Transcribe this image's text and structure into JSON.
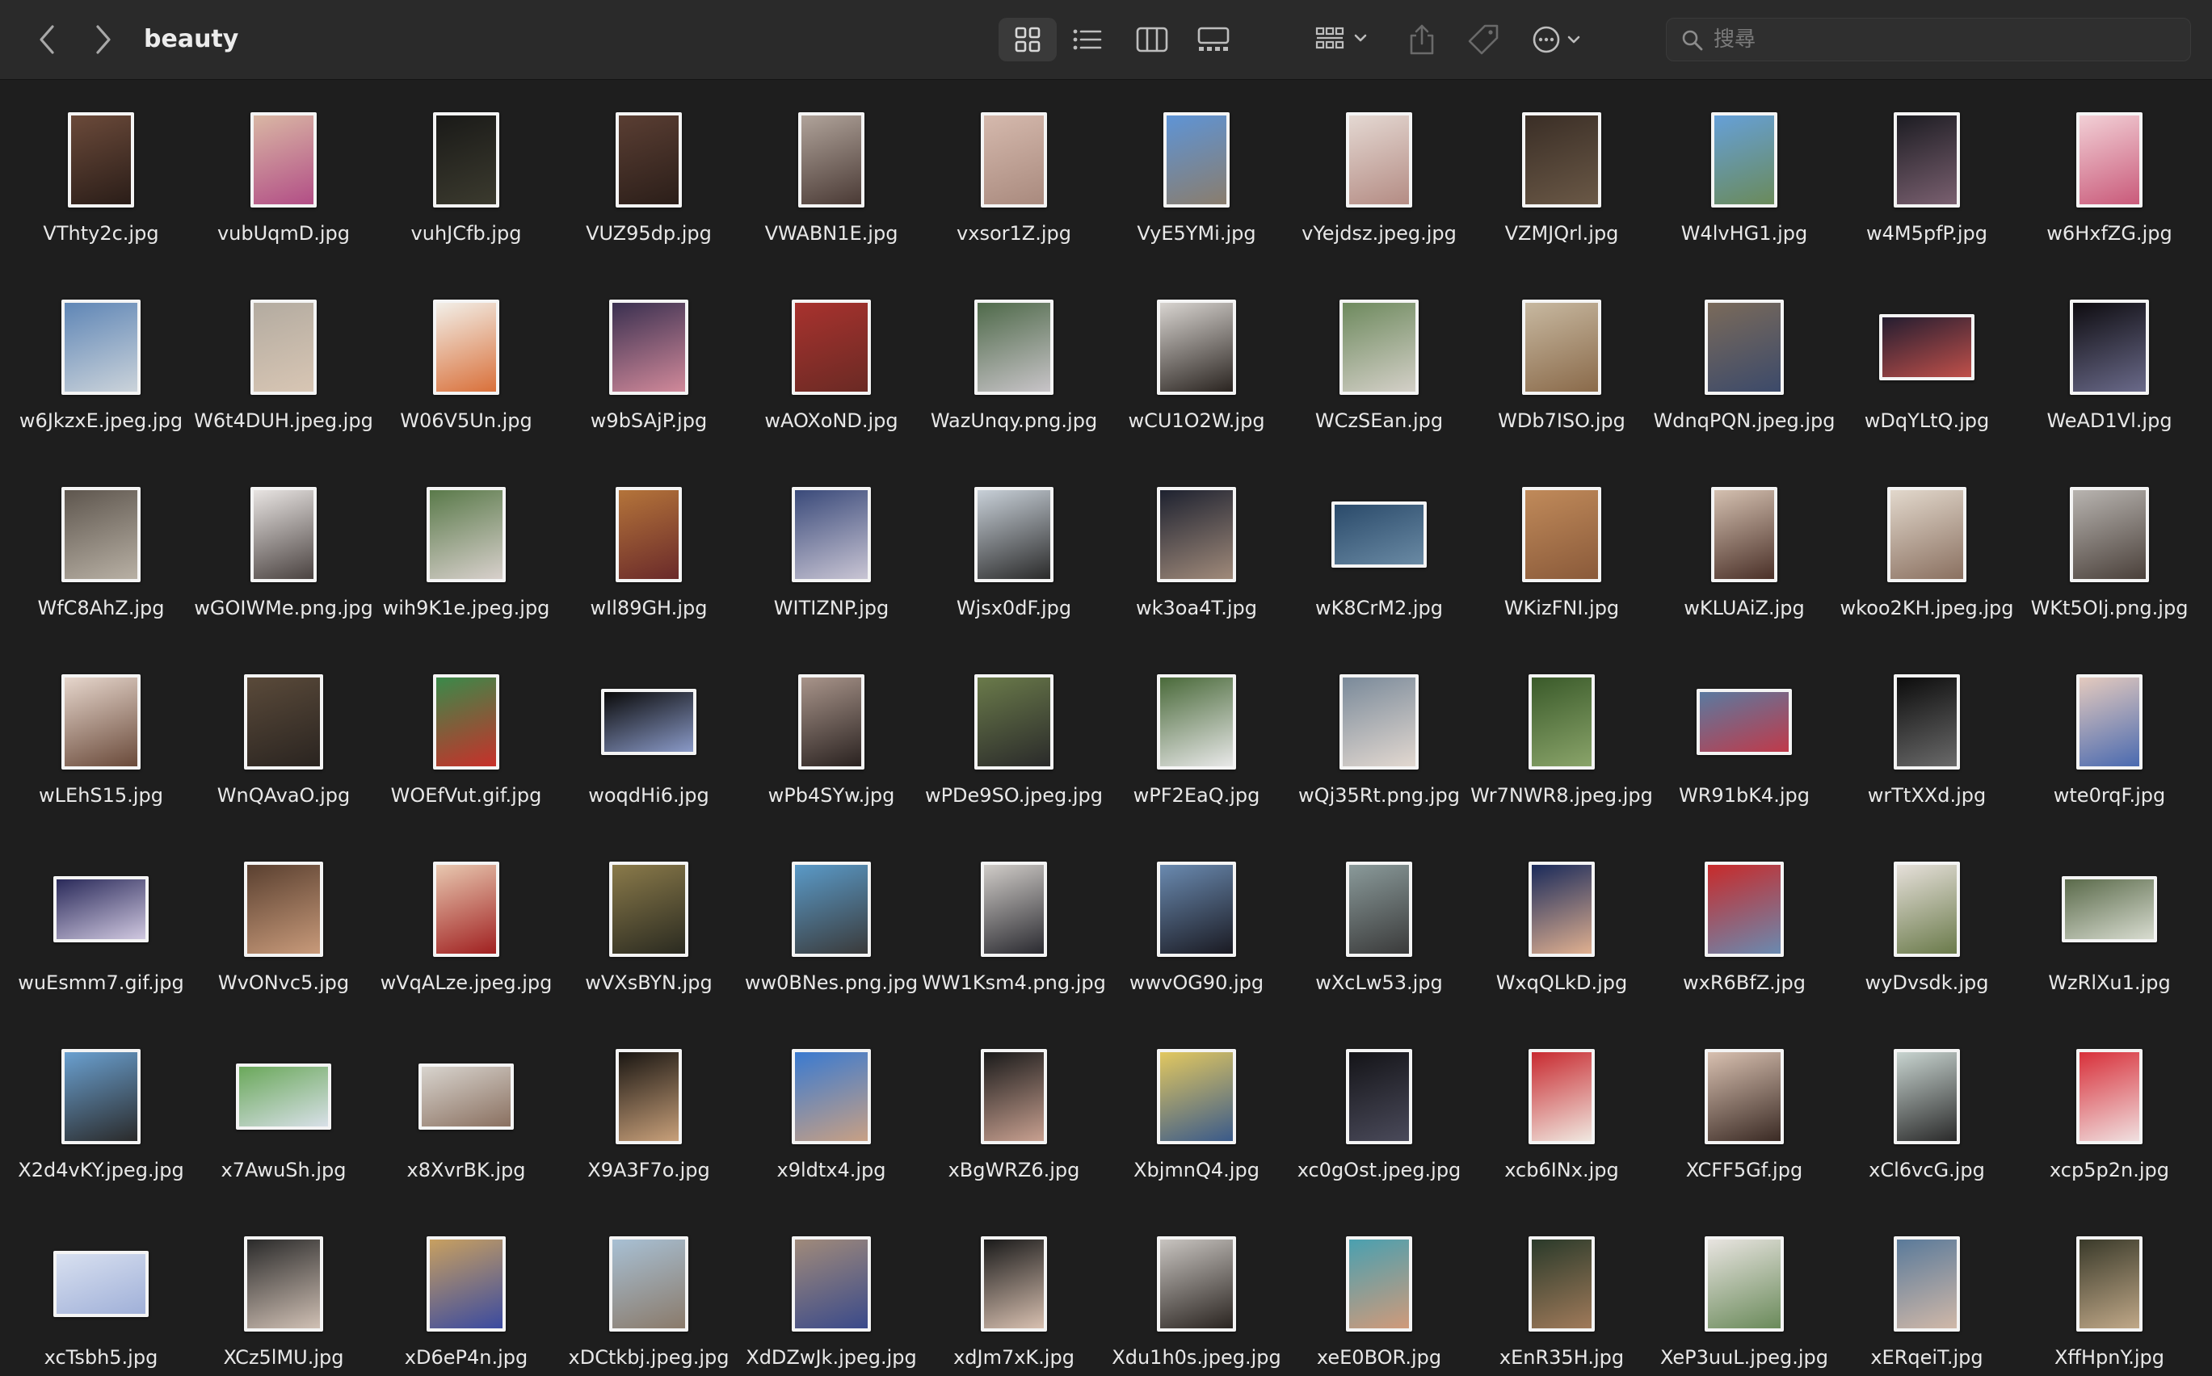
{
  "window": {
    "folder_title": "beauty",
    "search": {
      "placeholder": "搜尋",
      "value": ""
    }
  },
  "toolbar": {
    "icons": [
      "chevron-left-icon",
      "chevron-right-icon",
      "grid-icon",
      "list-icon",
      "columns-icon",
      "gallery-icon",
      "group-icon",
      "share-icon",
      "tag-icon",
      "more-icon",
      "search-icon"
    ],
    "active_view": "icon"
  },
  "colors": {
    "background": "#1e1e1e",
    "toolbar": "#2a2a2a",
    "text": "#e8e8e8",
    "thumb_border": "#f4f4f4"
  },
  "files": [
    {
      "name": "VThty2c.jpg",
      "shape": "p",
      "colors": [
        "#6b4a3a",
        "#2a1d18"
      ]
    },
    {
      "name": "vubUqmD.jpg",
      "shape": "p",
      "colors": [
        "#d9b7a4",
        "#b24e86"
      ]
    },
    {
      "name": "vuhJCfb.jpg",
      "shape": "p",
      "colors": [
        "#1a1a18",
        "#3b3a2e"
      ]
    },
    {
      "name": "VUZ95dp.jpg",
      "shape": "p",
      "colors": [
        "#5a3e33",
        "#2b1e19"
      ]
    },
    {
      "name": "VWABN1E.jpg",
      "shape": "p",
      "colors": [
        "#b0a39a",
        "#4a3a35"
      ]
    },
    {
      "name": "vxsor1Z.jpg",
      "shape": "p",
      "colors": [
        "#d5b9ad",
        "#a98a7e"
      ]
    },
    {
      "name": "VyE5YMi.jpg",
      "shape": "p",
      "colors": [
        "#5e94d6",
        "#8a7d6d"
      ]
    },
    {
      "name": "vYejdsz.jpeg.jpg",
      "shape": "p",
      "colors": [
        "#e4d8d2",
        "#b48c84"
      ]
    },
    {
      "name": "VZMJQrl.jpg",
      "shape": "s",
      "colors": [
        "#3a2e26",
        "#6a5846"
      ]
    },
    {
      "name": "W4lvHG1.jpg",
      "shape": "p",
      "colors": [
        "#66a0d8",
        "#6a8a5a"
      ]
    },
    {
      "name": "w4M5pfP.jpg",
      "shape": "p",
      "colors": [
        "#1c1c22",
        "#7a6070"
      ]
    },
    {
      "name": "w6HxfZG.jpg",
      "shape": "p",
      "colors": [
        "#f2d0d6",
        "#c95a7a"
      ]
    },
    {
      "name": "w6JkzxE.jpeg.jpg",
      "shape": "s",
      "colors": [
        "#5f86b6",
        "#cbd3da"
      ]
    },
    {
      "name": "W6t4DUH.jpeg.jpg",
      "shape": "p",
      "colors": [
        "#b3aba0",
        "#d8c6b4"
      ]
    },
    {
      "name": "W06V5Un.jpg",
      "shape": "p",
      "colors": [
        "#f2efe8",
        "#d9703a"
      ]
    },
    {
      "name": "w9bSAjP.jpg",
      "shape": "s",
      "colors": [
        "#3a3050",
        "#d1899a"
      ]
    },
    {
      "name": "wAOXoND.jpg",
      "shape": "s",
      "colors": [
        "#a8322e",
        "#6a2a24"
      ]
    },
    {
      "name": "WazUnqy.png.jpg",
      "shape": "s",
      "colors": [
        "#4f6a4a",
        "#c8c4c8"
      ]
    },
    {
      "name": "wCU1O2W.jpg",
      "shape": "s",
      "colors": [
        "#d8d4d0",
        "#2a2420"
      ]
    },
    {
      "name": "WCzSEan.jpg",
      "shape": "s",
      "colors": [
        "#6e8a5e",
        "#d4d0c8"
      ]
    },
    {
      "name": "WDb7ISO.jpg",
      "shape": "s",
      "colors": [
        "#c7b8a0",
        "#8a6a4a"
      ]
    },
    {
      "name": "WdnqPQN.jpeg.jpg",
      "shape": "s",
      "colors": [
        "#7a6a5a",
        "#3c4a6a"
      ]
    },
    {
      "name": "wDqYLtQ.jpg",
      "shape": "l",
      "colors": [
        "#241d30",
        "#c0504a"
      ]
    },
    {
      "name": "WeAD1Vl.jpg",
      "shape": "s",
      "colors": [
        "#0e0c10",
        "#6a6a8a"
      ]
    },
    {
      "name": "WfC8AhZ.jpg",
      "shape": "s",
      "colors": [
        "#5e564e",
        "#b8b0a4"
      ]
    },
    {
      "name": "wGOIWMe.png.jpg",
      "shape": "p",
      "colors": [
        "#e8e4e2",
        "#4a4240"
      ]
    },
    {
      "name": "wih9K1e.jpeg.jpg",
      "shape": "s",
      "colors": [
        "#5a7a4a",
        "#d8d0cc"
      ]
    },
    {
      "name": "wIl89GH.jpg",
      "shape": "p",
      "colors": [
        "#b4743a",
        "#6a2a2a"
      ]
    },
    {
      "name": "WITIZNP.jpg",
      "shape": "s",
      "colors": [
        "#3a4a7a",
        "#c9c5d4"
      ]
    },
    {
      "name": "Wjsx0dF.jpg",
      "shape": "s",
      "colors": [
        "#c8d0d8",
        "#2a2a2a"
      ]
    },
    {
      "name": "wk3oa4T.jpg",
      "shape": "s",
      "colors": [
        "#1e2230",
        "#a08a7a"
      ]
    },
    {
      "name": "wK8CrM2.jpg",
      "shape": "l",
      "colors": [
        "#2a4a6a",
        "#6a8aa4"
      ]
    },
    {
      "name": "WKizFNI.jpg",
      "shape": "s",
      "colors": [
        "#c08a5a",
        "#8a5a3a"
      ]
    },
    {
      "name": "wKLUAiZ.jpg",
      "shape": "p",
      "colors": [
        "#d4c0b0",
        "#4a3028"
      ]
    },
    {
      "name": "wkoo2KH.jpeg.jpg",
      "shape": "s",
      "colors": [
        "#e2d8cc",
        "#8a7060"
      ]
    },
    {
      "name": "WKt5OIj.png.jpg",
      "shape": "s",
      "colors": [
        "#b8b4b0",
        "#4a403a"
      ]
    },
    {
      "name": "wLEhS15.jpg",
      "shape": "s",
      "colors": [
        "#e6d6cc",
        "#6a4a3a"
      ]
    },
    {
      "name": "WnQAvaO.jpg",
      "shape": "s",
      "colors": [
        "#5a4a3a",
        "#2a2420"
      ]
    },
    {
      "name": "WOEfVut.gif.jpg",
      "shape": "p",
      "colors": [
        "#3a8a4a",
        "#c8302a"
      ]
    },
    {
      "name": "woqdHi6.jpg",
      "shape": "l",
      "colors": [
        "#0a0a0a",
        "#8a9ac8"
      ]
    },
    {
      "name": "wPb4SYw.jpg",
      "shape": "p",
      "colors": [
        "#a8948a",
        "#2a2220"
      ]
    },
    {
      "name": "wPDe9SO.jpeg.jpg",
      "shape": "s",
      "colors": [
        "#6a7a4a",
        "#2a2a2a"
      ]
    },
    {
      "name": "wPF2EaQ.jpg",
      "shape": "s",
      "colors": [
        "#4a6a3a",
        "#e8e8e8"
      ]
    },
    {
      "name": "wQj35Rt.png.jpg",
      "shape": "s",
      "colors": [
        "#7a8a9a",
        "#e2d8d0"
      ]
    },
    {
      "name": "Wr7NWR8.jpeg.jpg",
      "shape": "p",
      "colors": [
        "#3a5a2a",
        "#8aa46a"
      ]
    },
    {
      "name": "WR91bK4.jpg",
      "shape": "l",
      "colors": [
        "#5a7aa0",
        "#c03a4a"
      ]
    },
    {
      "name": "wrTtXXd.jpg",
      "shape": "p",
      "colors": [
        "#0c0c0c",
        "#6a6a6a"
      ]
    },
    {
      "name": "wte0rqF.jpg",
      "shape": "p",
      "colors": [
        "#e4cabe",
        "#4a6ab0"
      ]
    },
    {
      "name": "wuEsmm7.gif.jpg",
      "shape": "l",
      "colors": [
        "#2a2a5a",
        "#d0c8e0"
      ]
    },
    {
      "name": "WvONvc5.jpg",
      "shape": "s",
      "colors": [
        "#5a4030",
        "#c89a7a"
      ]
    },
    {
      "name": "wVqALze.jpeg.jpg",
      "shape": "p",
      "colors": [
        "#e8c8b0",
        "#a02020"
      ]
    },
    {
      "name": "wVXsBYN.jpg",
      "shape": "s",
      "colors": [
        "#8a7a4a",
        "#2a2a20"
      ]
    },
    {
      "name": "ww0BNes.png.jpg",
      "shape": "s",
      "colors": [
        "#5a9ac8",
        "#3a3a3a"
      ]
    },
    {
      "name": "WW1Ksm4.png.jpg",
      "shape": "p",
      "colors": [
        "#d0ccc8",
        "#2a2a30"
      ]
    },
    {
      "name": "wwvOG90.jpg",
      "shape": "s",
      "colors": [
        "#6a8ab0",
        "#1a1a22"
      ]
    },
    {
      "name": "wXcLw53.jpg",
      "shape": "p",
      "colors": [
        "#8a9a9a",
        "#3a3a3a"
      ]
    },
    {
      "name": "WxqQLkD.jpg",
      "shape": "p",
      "colors": [
        "#1a2a5a",
        "#e0b090"
      ]
    },
    {
      "name": "wxR6BfZ.jpg",
      "shape": "s",
      "colors": [
        "#c82a2a",
        "#6a8ab0"
      ]
    },
    {
      "name": "wyDvsdk.jpg",
      "shape": "p",
      "colors": [
        "#e6e0da",
        "#6a7a4a"
      ]
    },
    {
      "name": "WzRlXu1.jpg",
      "shape": "l",
      "colors": [
        "#5a6a4a",
        "#d8dcd0"
      ]
    },
    {
      "name": "X2d4vKY.jpeg.jpg",
      "shape": "s",
      "colors": [
        "#6aa0d0",
        "#2a2a2a"
      ]
    },
    {
      "name": "x7AwuSh.jpg",
      "shape": "l",
      "colors": [
        "#6aa85a",
        "#d8e0e8"
      ]
    },
    {
      "name": "x8XvrBK.jpg",
      "shape": "l",
      "colors": [
        "#d8d4ce",
        "#8a7060"
      ]
    },
    {
      "name": "X9A3F7o.jpg",
      "shape": "p",
      "colors": [
        "#1a1612",
        "#c8a07a"
      ]
    },
    {
      "name": "x9ldtx4.jpg",
      "shape": "s",
      "colors": [
        "#3a7ad0",
        "#c8a084"
      ]
    },
    {
      "name": "xBgWRZ6.jpg",
      "shape": "p",
      "colors": [
        "#1a1a1a",
        "#c8a090"
      ]
    },
    {
      "name": "XbjmnQ4.jpg",
      "shape": "s",
      "colors": [
        "#e2c860",
        "#3a5a8a"
      ]
    },
    {
      "name": "xc0gOst.jpeg.jpg",
      "shape": "p",
      "colors": [
        "#141418",
        "#4a4a5a"
      ]
    },
    {
      "name": "xcb6INx.jpg",
      "shape": "p",
      "colors": [
        "#c82a30",
        "#f0e8e0"
      ]
    },
    {
      "name": "XCFF5Gf.jpg",
      "shape": "s",
      "colors": [
        "#d8c0b0",
        "#3a2a24"
      ]
    },
    {
      "name": "xCl6vcG.jpg",
      "shape": "p",
      "colors": [
        "#c8d4d0",
        "#2a2a2a"
      ]
    },
    {
      "name": "xcp5p2n.jpg",
      "shape": "p",
      "colors": [
        "#d8303a",
        "#f0e0e0"
      ]
    },
    {
      "name": "xcTsbh5.jpg",
      "shape": "l",
      "colors": [
        "#d8e0f0",
        "#a0b0d8"
      ]
    },
    {
      "name": "XCz5lMU.jpg",
      "shape": "s",
      "colors": [
        "#2a2a2a",
        "#d0c0b4"
      ]
    },
    {
      "name": "xD6eP4n.jpg",
      "shape": "s",
      "colors": [
        "#c8a060",
        "#3a4aa0"
      ]
    },
    {
      "name": "xDCtkbj.jpeg.jpg",
      "shape": "s",
      "colors": [
        "#a8c0d4",
        "#8a7a6a"
      ]
    },
    {
      "name": "XdDZwJk.jpeg.jpg",
      "shape": "s",
      "colors": [
        "#a08a7a",
        "#3a4a8a"
      ]
    },
    {
      "name": "xdJm7xK.jpg",
      "shape": "p",
      "colors": [
        "#1a1a1a",
        "#d8c0b0"
      ]
    },
    {
      "name": "Xdu1h0s.jpeg.jpg",
      "shape": "s",
      "colors": [
        "#c8c4c0",
        "#2a2420"
      ]
    },
    {
      "name": "xeE0BOR.jpg",
      "shape": "p",
      "colors": [
        "#4aa0b0",
        "#d09a7a"
      ]
    },
    {
      "name": "xEnR35H.jpg",
      "shape": "p",
      "colors": [
        "#2a3a2a",
        "#a07a5a"
      ]
    },
    {
      "name": "XeP3uuL.jpeg.jpg",
      "shape": "s",
      "colors": [
        "#e8e4e0",
        "#6a8a5a"
      ]
    },
    {
      "name": "xERqeiT.jpg",
      "shape": "p",
      "colors": [
        "#5a7a9a",
        "#d0b8a8"
      ]
    },
    {
      "name": "XffHpnY.jpg",
      "shape": "p",
      "colors": [
        "#3a3a2a",
        "#c0a888"
      ]
    }
  ]
}
